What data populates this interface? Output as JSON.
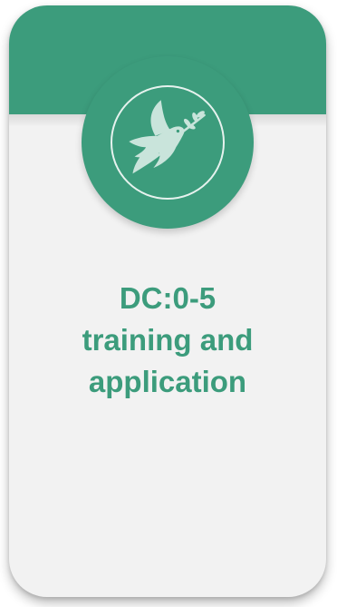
{
  "card": {
    "title_lines": [
      "DC:0-5",
      "training and",
      "application"
    ],
    "icon": "dove-with-olive-branch-icon",
    "colors": {
      "accent": "#3c9c7c",
      "background": "#f2f2f2",
      "icon_fill": "#c9e4db"
    }
  }
}
